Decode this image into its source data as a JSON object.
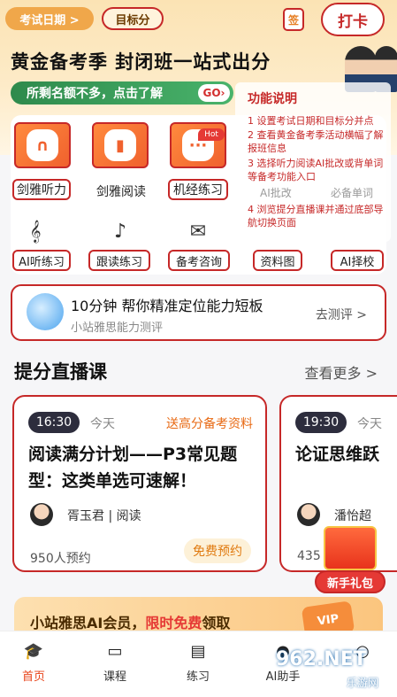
{
  "header": {
    "exam_date_label": "考试日期 >",
    "target_score_label": "目标分",
    "calendar_icon_glyph": "签",
    "checkin_label": "打卡"
  },
  "promo": {
    "title": "黄金备考季 封闭班一站式出分",
    "banner_text": "所剩名额不多，点击了解",
    "go_label": "GO›"
  },
  "features": {
    "main": [
      {
        "label": "剑雅听力",
        "icon": "headphones-icon",
        "glyph": "∩"
      },
      {
        "label": "剑雅阅读",
        "icon": "book-icon",
        "glyph": "▮"
      },
      {
        "label": "机经练习",
        "icon": "chat-bubble-icon",
        "glyph": "···"
      }
    ],
    "hot_badge": "Hot",
    "secondary": [
      {
        "label": "AI听练习",
        "glyph": "𝄞"
      },
      {
        "label": "跟读练习",
        "glyph": "♪"
      },
      {
        "label": "备考咨询",
        "glyph": "✉"
      },
      {
        "label": "资料图",
        "glyph": ""
      },
      {
        "label": "AI择校",
        "glyph": ""
      }
    ],
    "ghost_labels": [
      "AI批改",
      "必备单词"
    ]
  },
  "overlay": {
    "title": "功能说明",
    "steps": [
      "1  设置考试日期和目标分并点",
      "2  查看黄金备考季活动横幅了解报班信息",
      "3  选择听力阅读AI批改或背单词等备考功能入口",
      "4  浏览提分直播课并通过底部导航切换页面"
    ]
  },
  "assessment": {
    "title": "10分钟 帮你精准定位能力短板",
    "subtitle": "小站雅思能力测评",
    "action": "去测评 >"
  },
  "live": {
    "heading": "提分直播课",
    "see_more": "查看更多 >",
    "courses": [
      {
        "time": "16:30",
        "day": "今天",
        "tag": "送高分备考资料",
        "title": "阅读满分计划——P3常见题型：这类单选可速解！",
        "teacher": "胥玉君 | 阅读",
        "booked": "950人预约",
        "action": "免费预约"
      },
      {
        "time": "19:30",
        "day": "今天",
        "tag": "",
        "title": "论证思维跃",
        "teacher": "潘怡超",
        "booked": "435",
        "action": ""
      }
    ]
  },
  "gift": {
    "label": "新手礼包"
  },
  "ai_banner": {
    "prefix": "小站雅思AI会员，",
    "highlight": "限时免费",
    "suffix": "领取",
    "badge": "VIP"
  },
  "nav": [
    {
      "label": "首页",
      "icon": "graduation-cap-icon",
      "glyph": "🎓"
    },
    {
      "label": "课程",
      "icon": "monitor-icon",
      "glyph": "▭"
    },
    {
      "label": "练习",
      "icon": "open-book-icon",
      "glyph": "▤"
    },
    {
      "label": "AI助手",
      "icon": "ai-assistant-icon",
      "glyph": "●"
    },
    {
      "label": "",
      "icon": "profile-icon",
      "glyph": "○"
    }
  ],
  "watermark": {
    "text": "962.NET",
    "sub": "乐游网"
  },
  "colors": {
    "accent": "#e8441a",
    "annotation_red": "#c62828",
    "promo_green": "#2e8a4c"
  }
}
